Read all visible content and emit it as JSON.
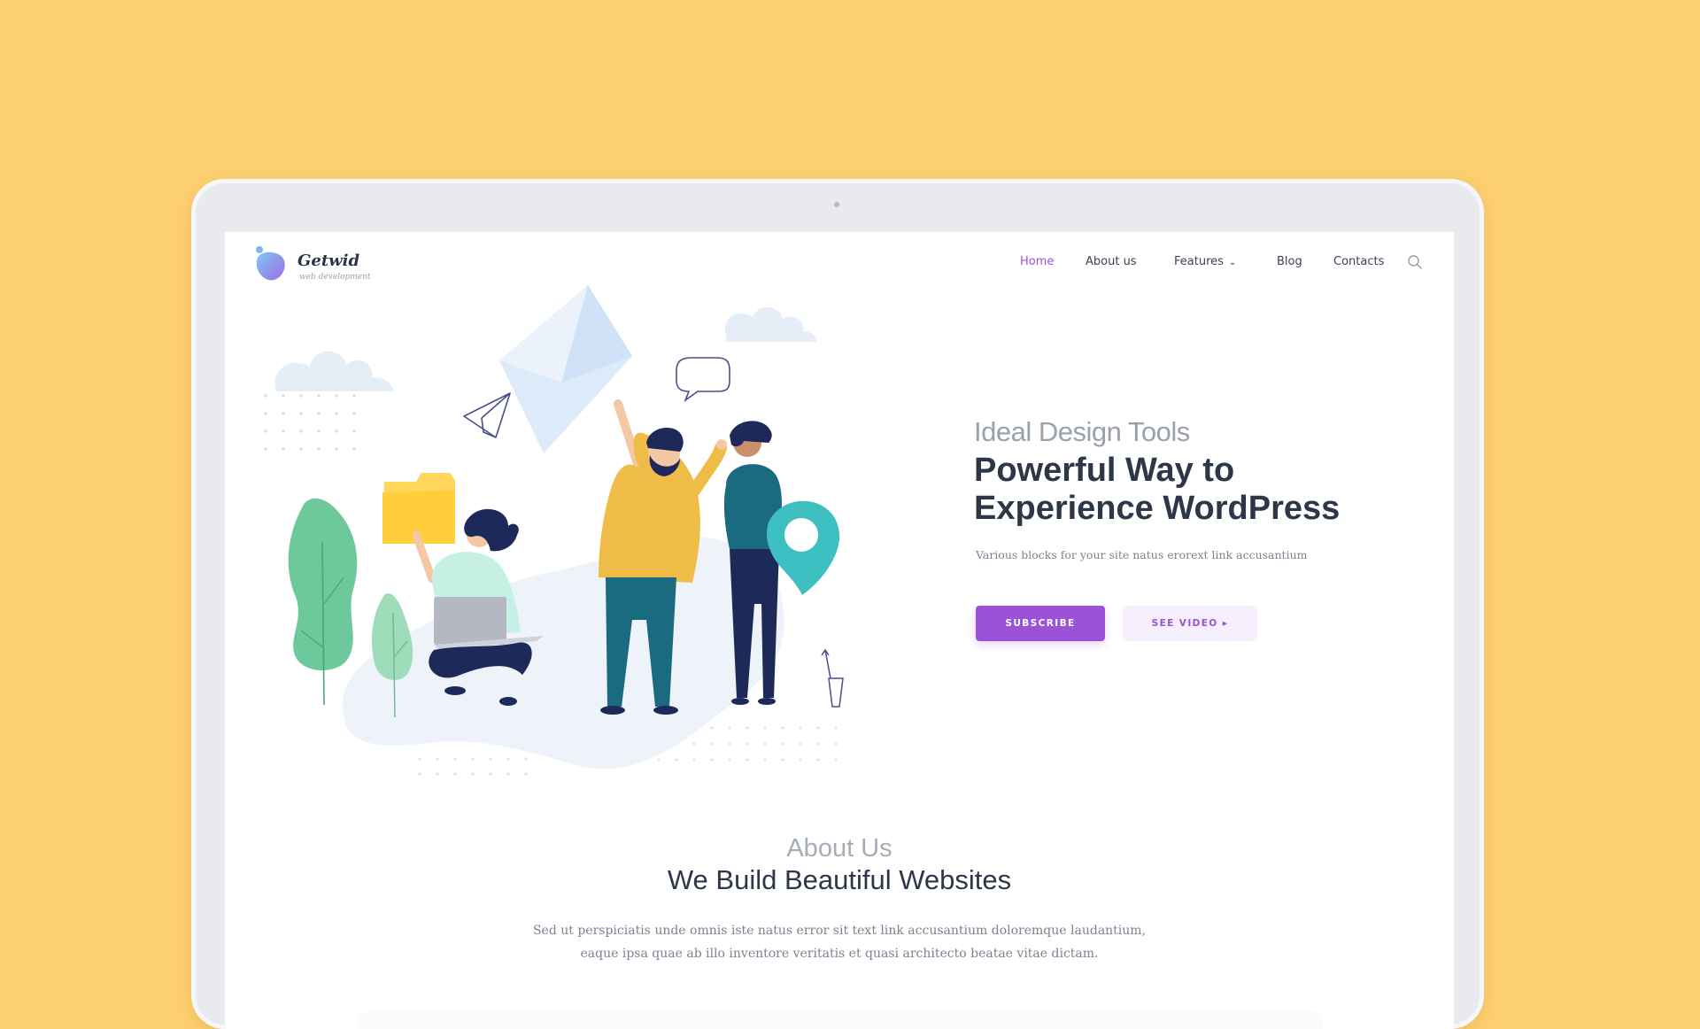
{
  "brand": {
    "name": "Getwid",
    "tagline": "web development"
  },
  "nav": {
    "items": [
      {
        "label": "Home",
        "active": true
      },
      {
        "label": "About us",
        "active": false
      },
      {
        "label": "Features",
        "active": false
      },
      {
        "label": "Blog",
        "active": false
      },
      {
        "label": "Contacts",
        "active": false
      }
    ],
    "search_icon": "search-icon"
  },
  "hero": {
    "eyebrow": "Ideal Design Tools",
    "headline_line1": "Powerful Way to",
    "headline_line2": "Experience WordPress",
    "subtitle": "Various blocks for your site natus erorext link accusantium",
    "primary_button": "SUBSCRIBE",
    "secondary_button": "SEE VIDEO ▸"
  },
  "about": {
    "eyebrow": "About Us",
    "title": "We Build Beautiful Websites",
    "body_line1": "Sed ut perspiciatis unde omnis iste natus error sit text link accusantium doloremque laudantium,",
    "body_line2": "eaque ipsa quae ab illo inventore veritatis et quasi architecto beatae vitae dictam."
  },
  "colors": {
    "background": "#fdd072",
    "accent": "#9b52d8",
    "heading": "#2d3748",
    "muted": "#9aa1ad"
  }
}
